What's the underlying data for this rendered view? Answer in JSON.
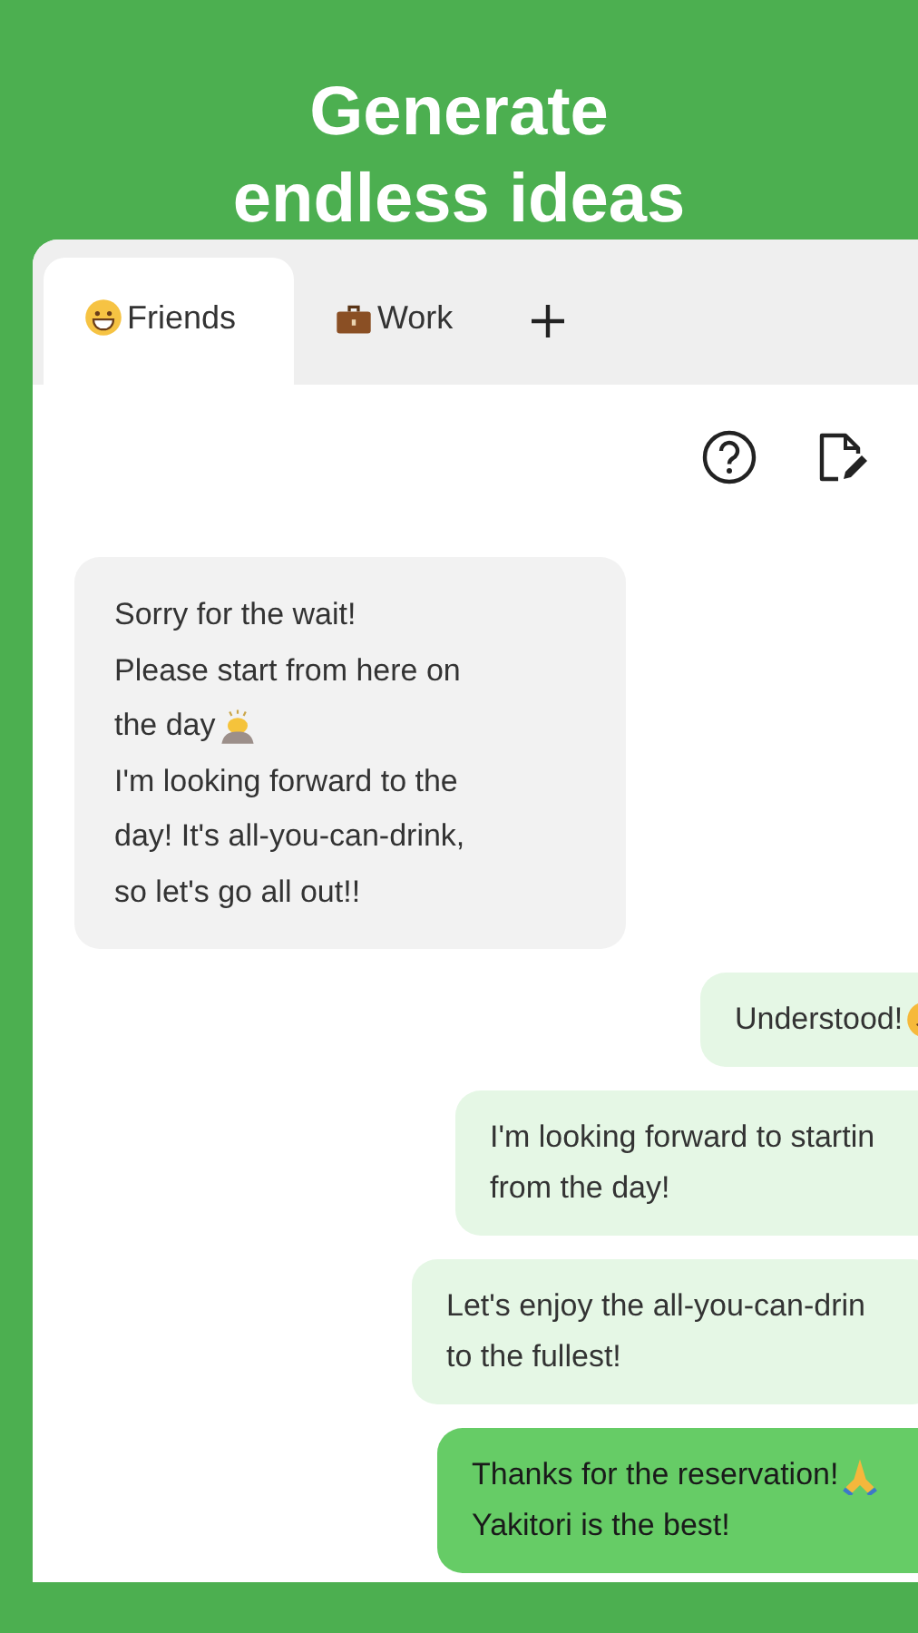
{
  "headline": [
    "Generate",
    "endless ideas"
  ],
  "tabs": [
    {
      "label": "Friends",
      "selected": true
    },
    {
      "label": "Work",
      "selected": false
    }
  ],
  "messages": [
    {
      "kind": "received",
      "highlighted": false,
      "lines": [
        "Sorry for the wait!",
        "Please start from here on",
        "the day",
        "I'm looking forward to the",
        "day! It's all-you-can-drink,",
        "so let's go all out!!"
      ]
    },
    {
      "kind": "sent",
      "highlighted": false,
      "lines": [
        "Understood!"
      ]
    },
    {
      "kind": "sent",
      "highlighted": false,
      "lines": [
        "I'm looking forward to startin",
        "from the day!"
      ]
    },
    {
      "kind": "sent",
      "highlighted": false,
      "lines": [
        "Let's enjoy the all-you-can-drin",
        "to the fullest!"
      ]
    },
    {
      "kind": "sent",
      "highlighted": true,
      "lines": [
        "Thanks for the reservation!",
        "Yakitori is the best!"
      ]
    }
  ]
}
